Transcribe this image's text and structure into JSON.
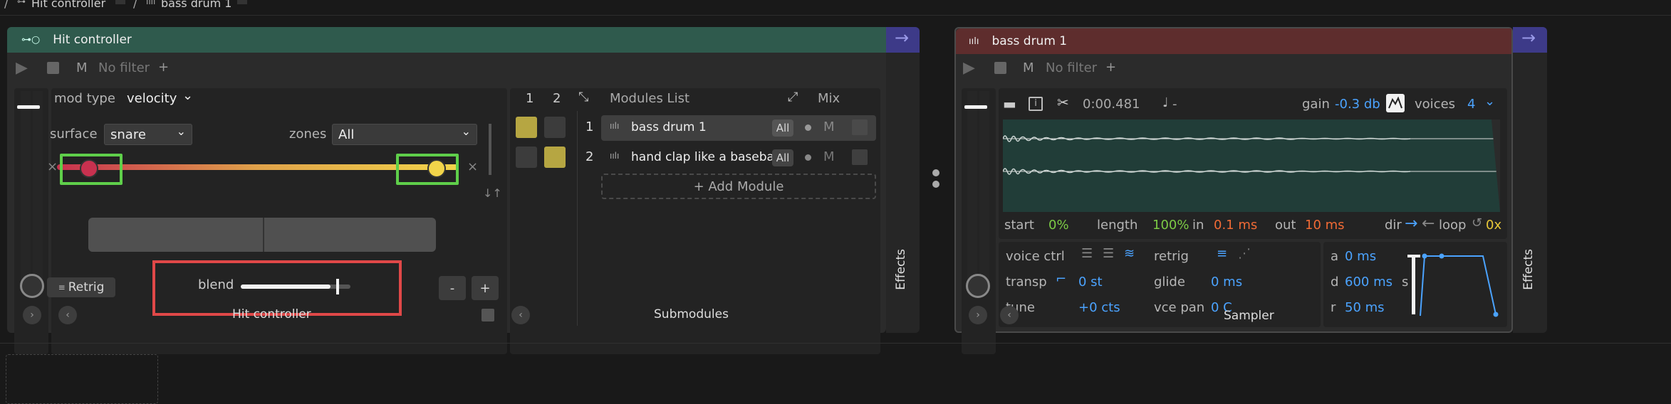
{
  "breadcrumb": {
    "item1": "Hit controller",
    "item2": "bass drum 1"
  },
  "hit": {
    "title": "Hit controller",
    "filter": "No filter",
    "mute": "M",
    "plus": "+",
    "mod_type_label": "mod type",
    "mod_type_value": "velocity",
    "surface_label": "surface",
    "surface_value": "snare",
    "zones_label": "zones",
    "zones_value": "All",
    "retrig": "Retrig",
    "blend_label": "blend",
    "blend_value": 0.82,
    "minus": "-",
    "plus_btn": "+",
    "footer": "Hit controller"
  },
  "submodules": {
    "col1": "1",
    "col2": "2",
    "list_title": "Modules List",
    "mix": "Mix",
    "rows": [
      {
        "num": "1",
        "name": "bass drum 1",
        "all": "All",
        "m": "M"
      },
      {
        "num": "2",
        "name": "hand clap like a baseba",
        "all": "All",
        "m": "M"
      }
    ],
    "add": "+ Add Module",
    "footer": "Submodules"
  },
  "effects_label": "Effects",
  "sampler": {
    "title": "bass drum 1",
    "filter": "No filter",
    "mute": "M",
    "plus": "+",
    "time": "0:00.481",
    "note": "-",
    "gain_label": "gain",
    "gain_value": "-0.3 db",
    "voices_label": "voices",
    "voices_value": "4",
    "start_label": "start",
    "start_value": "0%",
    "length_label": "length",
    "length_value": "100%",
    "in_label": "in",
    "in_value": "0.1 ms",
    "out_label": "out",
    "out_value": "10 ms",
    "dir_label": "dir",
    "loop_label": "loop",
    "loop_count": "0x",
    "voice_ctrl": "voice ctrl",
    "retrig": "retrig",
    "transp_label": "transp",
    "transp_value": "0 st",
    "glide_label": "glide",
    "glide_value": "0 ms",
    "tune_label": "tune",
    "tune_value": "+0 cts",
    "vcepan_label": "vce pan",
    "vcepan_value": "0 C",
    "a_label": "a",
    "a_value": "0 ms",
    "d_label": "d",
    "d_value": "600 ms",
    "s_label": "s",
    "r_label": "r",
    "r_value": "50 ms",
    "footer": "Sampler"
  },
  "colors": {
    "hit_header": "#2f5a4d",
    "sampler_header": "#5e2d2d",
    "accent": "#4ba3ff",
    "purple": "#3d3a88",
    "green_box": "#5fcf4a",
    "red_box": "#e04848"
  }
}
